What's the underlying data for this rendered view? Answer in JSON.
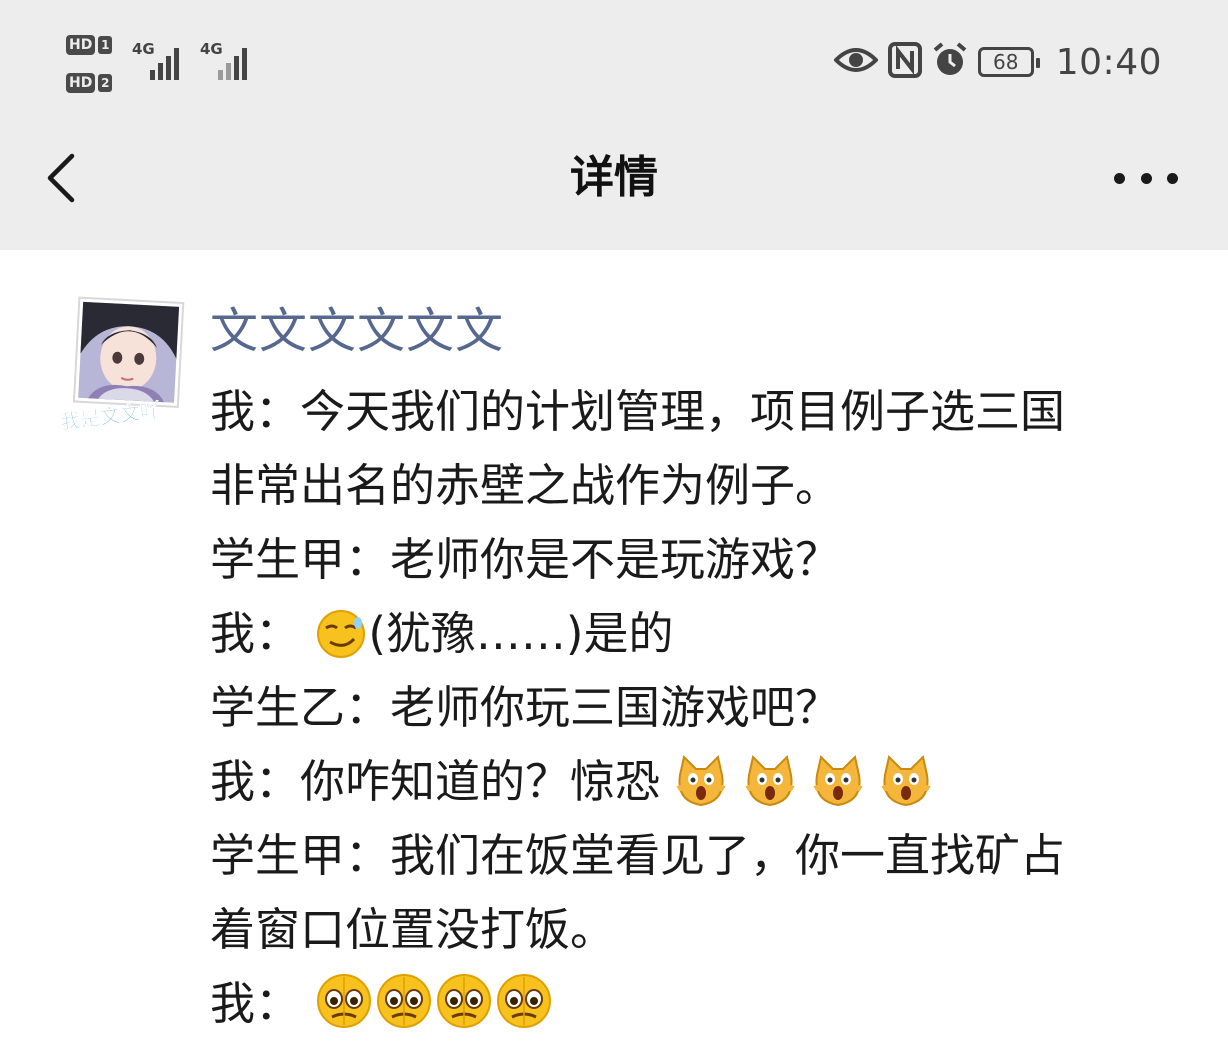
{
  "status_bar": {
    "sim1": "HD",
    "sim1_num": "1",
    "sim2": "HD",
    "sim2_num": "2",
    "net1": "4G",
    "net2": "4G",
    "battery": "68",
    "time": "10:40"
  },
  "nav": {
    "title": "详情"
  },
  "post": {
    "author": "文文文文文文",
    "avatar_caption": "我是文文吖",
    "lines": [
      "我：今天我们的计划管理，项目例子选三国",
      "非常出名的赤壁之战作为例子。",
      "学生甲：老师你是不是玩游戏？",
      "我：",
      "(犹豫……)是的",
      "学生乙：老师你玩三国游戏吧？",
      "我：你咋知道的？惊恐",
      "学生甲：我们在饭堂看见了，你一直找矿占",
      "着窗口位置没打饭。",
      "我："
    ]
  },
  "colors": {
    "header_bg": "#ededed",
    "author_name": "#56688f",
    "text": "#1a1a1a"
  },
  "icons": [
    "back-arrow-icon",
    "more-dots-icon",
    "eye-icon",
    "nfc-icon",
    "alarm-icon",
    "battery-icon",
    "signal-icon",
    "smirk-emoji",
    "scream-cat-emoji",
    "tearful-face-emoji"
  ]
}
